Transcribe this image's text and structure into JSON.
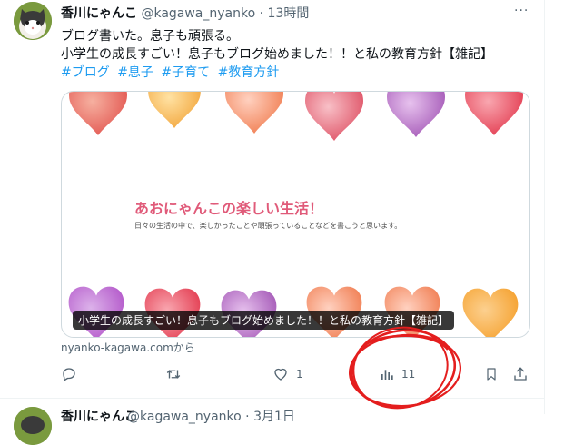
{
  "tweet": {
    "display_name": "香川にゃんこ",
    "handle": "@kagawa_nyanko",
    "separator": "·",
    "time": "13時間",
    "more": "···",
    "lines": [
      "ブログ書いた。息子も頑張る。",
      "小学生の成長すごい！息子もブログ始めました！！と私の教育方針【雑記】"
    ],
    "hashtags": [
      "#ブログ",
      "#息子",
      "#子育て",
      "#教育方針"
    ]
  },
  "card": {
    "heading": "あおにゃんこの楽しい生活！",
    "subheading": "日々の生活の中で、楽しかったことや頑張っていることなどを書こうと思います。",
    "title_banner": "小学生の成長すごい！息子もブログ始めました！！と私の教育方針【雑記】",
    "domain": "nyanko-kagawa.comから"
  },
  "actions": {
    "reply_count": "",
    "retweet_count": "",
    "like_count": "1",
    "view_count": "11"
  },
  "next_tweet": {
    "display_name": "香川にゃんこ",
    "rest": "@kagawa_nyanko · 3月1日"
  },
  "colors": {
    "link": "#1d9bf0",
    "muted": "#536471",
    "annotation_red": "#e41e1e"
  },
  "icons": [
    "cat-avatar",
    "more-icon",
    "reply-icon",
    "retweet-icon",
    "like-icon",
    "views-icon",
    "bookmark-icon",
    "share-icon"
  ]
}
